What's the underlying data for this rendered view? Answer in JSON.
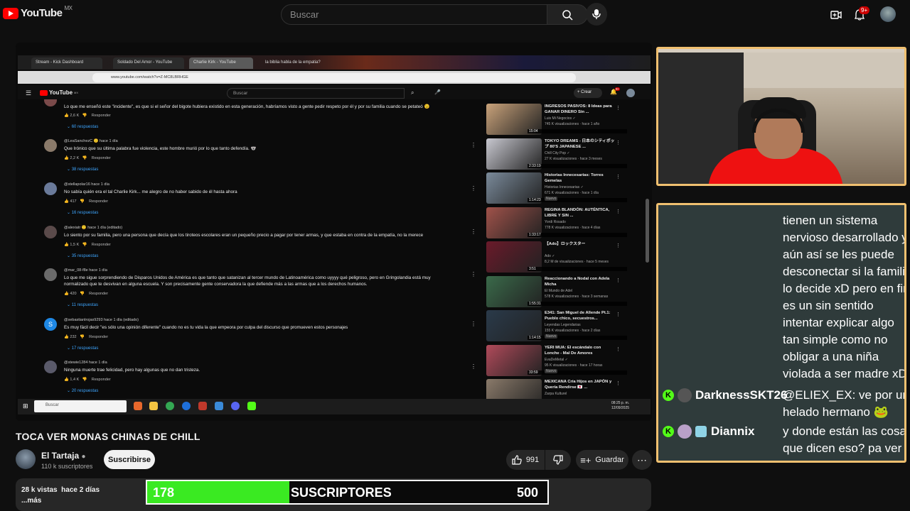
{
  "youtube": {
    "logo_text": "YouTube",
    "region": "MX",
    "search_placeholder": "Buscar",
    "notif_count": "9+"
  },
  "browser": {
    "tabs": [
      "Stream - Kick Dashboard",
      "Soldado Del Amor - YouTube",
      "Charlie Kirk - YouTube",
      "la biblia habla de la empatia?"
    ],
    "url": "www.youtube.com/watch?v=Z-MC8LBRHGE",
    "inner_logo": "YouTube",
    "inner_region": "MX",
    "inner_search": "Buscar",
    "create_label": "+ Crear",
    "inner_notif": "9+"
  },
  "comments": [
    {
      "user": "",
      "text": "Lo que me enseñó este \"incidente\", es que si el señor del bigote hubiera existido en esta generación, habríamos visto a gente pedir respeto por él y por su familia cuando se petateó 😉",
      "likes": "2,6 K",
      "reply": "Responder",
      "replies": "60 respuestas"
    },
    {
      "user": "@LeaSanchezC 🙂 hace 1 día",
      "text": "Que Irónico que su última palabra fue violencia, este hombre murió por lo que tanto defendía. 🐨",
      "likes": "2,2 K",
      "reply": "Responder",
      "replies": "38 respuestas"
    },
    {
      "user": "@stellapolar16 hace 1 día",
      "text": "No sabía quién era el tal Charlie Kirk... me alegro de no haber sabido de él hasta ahora",
      "likes": "417",
      "reply": "Responder",
      "replies": "16 respuestas"
    },
    {
      "user": "@alexiatr 🙂 hace 1 día (editado)",
      "text": "Lo siento por su familia, pero una persona que decía que los tiroteos escolares eran un pequeño precio a pagar por tener armas, y que estaba en contra de la empatía, no la merece",
      "likes": "1,5 K",
      "reply": "Responder",
      "replies": "35 respuestas"
    },
    {
      "user": "@mar_08-f8e hace 1 día",
      "text": "Lo que me sigue sorprendiendo de Disparos Unidos de América es que tanto que satanizan al tercer mundo de Latinoamérica como uyyyy qué peligroso, pero en Gringolandia está muy",
      "text2": "normalizado que te desvivan en alguna escuela. Y son precisamente gente conservadora la que defiende más a las armas que a los derechos humanos.",
      "likes": "420",
      "reply": "Responder",
      "replies": "11 respuestas"
    },
    {
      "user": "@sebastianlrojas9293 hace 1 día (editado)",
      "text": "Es muy fácil decir \"es sólo una opinión diferente\" cuando no es tu vida la que empeora por culpa del discurso que promueven estos personajes",
      "likes": "232",
      "reply": "Responder",
      "replies": "17 respuestas",
      "avatar_letter": "S"
    },
    {
      "user": "@stewie1284 hace 1 día",
      "text": "Ninguna muerte trae felicidad, pero hay algunas que no dan tristeza.",
      "likes": "1,4 K",
      "reply": "Responder",
      "replies": "20 respuestas"
    }
  ],
  "recommended": [
    {
      "title": "INGRESOS PASIVOS: 8 Ideas para GANAR DINERO Sin ...",
      "channel": "Luis Mi Negocios ✓",
      "meta": "745 K visualizaciones · hace 1 año",
      "duration": "15:04",
      "color": "#c9a27a"
    },
    {
      "title": "TOKYO DREAMS - 日本のシティポップ 80'S JAPANESE ...",
      "channel": "Chill City Pop ✓",
      "meta": "27 K visualizaciones · hace 3 meses",
      "duration": "2:33:19",
      "color": "#c8c8d0"
    },
    {
      "title": "Historias Innecesarias: Torres Gemelas",
      "channel": "Historias Innecesarias ✓",
      "meta": "671 K visualizaciones · hace 1 día",
      "duration": "1:14:23",
      "badge": "Nuevo",
      "color": "#7a8a9a"
    },
    {
      "title": "REGINA BLANDÓN: AUTÉNTICA, LIBRE Y SIN ...",
      "channel": "Yordi Rosado",
      "meta": "778 K visualizaciones · hace 4 días",
      "duration": "1:33:17",
      "color": "#a0524a"
    },
    {
      "title": "【Ado】ロックスター",
      "channel": "Ado ✓",
      "meta": "8,2 M de visualizaciones · hace 5 meses",
      "duration": "3:51",
      "color": "#6a1a2a"
    },
    {
      "title": "Reaccionando a Nodal con Adela Micha",
      "channel": "El Mundo de Adel",
      "meta": "578 K visualizaciones · hace 3 semanas",
      "duration": "1:55:31",
      "color": "#3a6a4a"
    },
    {
      "title": "E341: San Miguel de Allende Pt.1: Pueblo chico, secuestros...",
      "channel": "Leyendas Legendarias",
      "meta": "155 K visualizaciones · hace 2 días",
      "duration": "1:14:15",
      "badge": "Nuevo",
      "color": "#2a3a4a"
    },
    {
      "title": "YERI MUA: El escándalo con Lonche - Mal De Amores",
      "channel": "EvaDeMetal ✓",
      "meta": "95 K visualizaciones · hace 17 horas",
      "duration": "33:59",
      "badge": "Nuevo",
      "color": "#b04a5a"
    },
    {
      "title": "MEXICANA Cría Hijos en JAPÓN y Quería Rendirse 🇯🇵 ...",
      "channel": "Zarpa Kulturel",
      "meta": "",
      "duration": "",
      "color": "#8a7a6a"
    }
  ],
  "taskbar": {
    "search": "Buscar",
    "time": "08:25 p. m.",
    "date": "12/09/2025"
  },
  "video": {
    "title": "TOCA VER MONAS CHINAS DE CHILL",
    "channel": "El Tartaja",
    "subscribers": "110 k suscriptores",
    "subscribe_label": "Suscribirse",
    "likes": "991",
    "save_label": "Guardar",
    "views": "28 k vistas",
    "date": "hace 2 días",
    "more": "...más"
  },
  "sub_goal": {
    "current": "178",
    "label": "SUSCRIPTORES",
    "goal": "500",
    "progress_fraction": 0.356,
    "fill_color": "#3aea22"
  },
  "chat": {
    "overflow_lines": [
      "tienen un sistema",
      "nervioso desarrollado y",
      "aún así se les puede",
      "desconectar si la familia",
      "lo decide xD pero en fin.",
      "es un sin sentido",
      "intentar explicar algo",
      "tan simple como no",
      "obligar a una niña",
      "violada a ser madre xD"
    ],
    "messages": [
      {
        "user": "DarknessSKT26",
        "text1": "@ELIEX_EX: ve por un",
        "text2": "helado hermano 🐸"
      },
      {
        "user": "Diannix",
        "text1": "y donde están las cosas",
        "text2": "que dicen eso? pa ver"
      }
    ],
    "border_color": "#f0c070",
    "kick_color": "#53fc18"
  }
}
